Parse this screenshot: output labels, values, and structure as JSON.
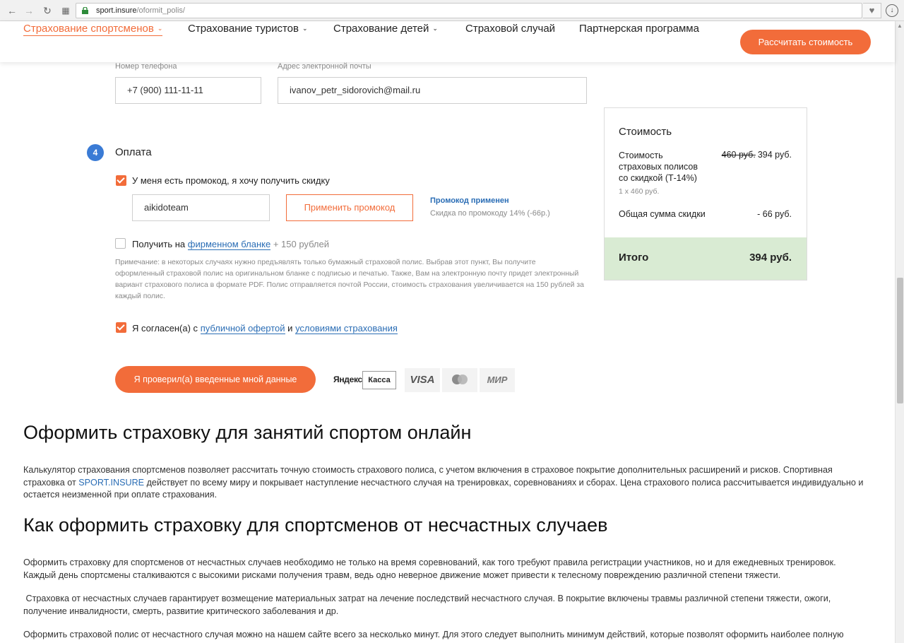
{
  "browser": {
    "url_host": "sport.insure",
    "url_path": "/oformit_polis/"
  },
  "nav": {
    "items": [
      {
        "label": "Страхование спортсменов",
        "active": true,
        "dropdown": true
      },
      {
        "label": "Страхование туристов",
        "active": false,
        "dropdown": true
      },
      {
        "label": "Страхование детей",
        "active": false,
        "dropdown": true
      },
      {
        "label": "Страховой случай",
        "active": false,
        "dropdown": false
      },
      {
        "label": "Партнерская программа",
        "active": false,
        "dropdown": false
      }
    ],
    "cta_label": "Рассчитать стоимость"
  },
  "contact": {
    "phone_label": "Номер телефона",
    "phone_value": "+7 (900) 111-11-11",
    "email_label": "Адрес электронной почты",
    "email_value": "ivanov_petr_sidorovich@mail.ru"
  },
  "payment": {
    "step_number": "4",
    "title": "Оплата",
    "promo_checkbox_label": "У меня есть промокод, я хочу получить скидку",
    "promo_checked": true,
    "promo_value": "aikidoteam",
    "apply_button": "Применить промокод",
    "promo_status": "Промокод применен",
    "promo_detail": "Скидка по промокоду 14% (-66р.)",
    "blank_prefix": "Получить на",
    "blank_link": "фирменном бланке",
    "blank_suffix": "+ 150 рублей",
    "blank_checked": false,
    "note": "Примечание: в некоторых случаях нужно предъявлять только бумажный страховой полис. Выбрав этот пункт, Вы получите оформленный страховой полис на оригинальном бланке с подписью и печатью. Также, Вам на электронную почту придет электронный вариант страхового полиса в формате PDF. Полис отправляется почтой России, стоимость страхования увеличивается на 150 рублей за каждый полис.",
    "agree_prefix": "Я согласен(а) с",
    "agree_link1": "публичной офертой",
    "agree_and": "и",
    "agree_link2": "условиями страхования",
    "agree_checked": true,
    "confirm_button": "Я проверил(а) введенные мной данные",
    "logos": {
      "yandex_text": "Яндекс",
      "yandex_box": "Касса",
      "visa": "VISA",
      "mir": "МИР"
    }
  },
  "summary": {
    "title": "Стоимость",
    "item_label": "Стоимость страховых полисов со скидкой (Т-14%)",
    "item_qty": "1 x 460 руб.",
    "old_price": "460 руб.",
    "new_price": "394 руб.",
    "discount_label": "Общая сумма скидки",
    "discount_value": "- 66 руб.",
    "total_label": "Итого",
    "total_value": "394 руб."
  },
  "article": {
    "h1": "Оформить страховку для занятий спортом онлайн",
    "p1_a": "Калькулятор страхования спортсменов позволяет рассчитать точную стоимость страхового полиса, с учетом включения в страховое покрытие дополнительных расширений и рисков. Спортивная страховка от",
    "p1_brand": "SPORT.INSURE",
    "p1_b": "действует по всему миру и покрывает наступление несчастного случая на тренировках, соревнованиях и сборах. Цена страхового полиса рассчитывается индивидуально и остается неизменной при оплате страхования.",
    "h2": "Как оформить страховку для спортсменов от несчастных случаев",
    "p2": "Оформить страховку для спортсменов от несчастных случаев необходимо не только на время соревнований, как того требуют правила регистрации участников, но и для ежедневных тренировок. Каждый день спортсмены сталкиваются с высокими рисками получения травм, ведь одно неверное движение может привести к телесному повреждению различной степени тяжести.",
    "p3": " Страховка от несчастных случаев гарантирует возмещение материальных затрат на лечение последствий несчастного случая. В покрытие включены травмы различной степени тяжести, ожоги, получение инвалидности, смерть, развитие критического заболевания и др.",
    "p4": "Оформить страховой полис от несчастного случая можно на нашем сайте всего за несколько минут. Для этого следует выполнить минимум действий, которые позволят оформить наиболее полную"
  },
  "colors": {
    "accent": "#f26c3a",
    "link": "#2a6db5",
    "step_badge": "#3a7bd5",
    "total_bg": "#d9ebd3"
  }
}
